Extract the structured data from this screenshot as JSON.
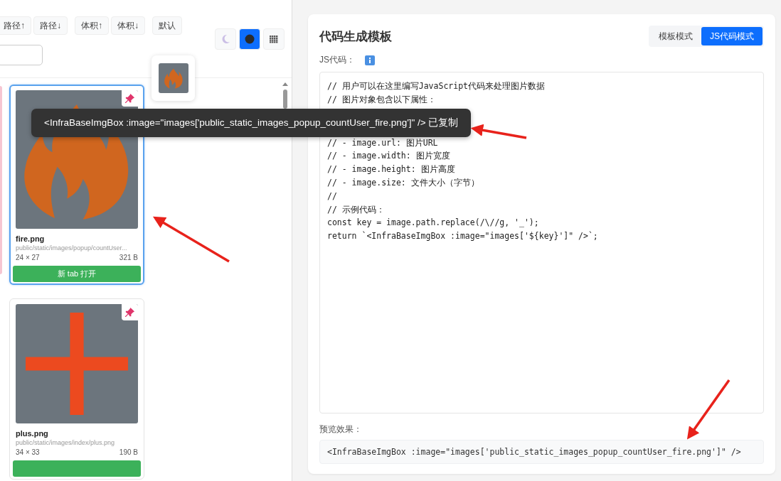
{
  "sort_groups": [
    [
      {
        "label": "路径↑"
      },
      {
        "label": "路径↓"
      }
    ],
    [
      {
        "label": "体积↑"
      },
      {
        "label": "体积↓"
      }
    ],
    [
      {
        "label": "默认"
      }
    ]
  ],
  "view_modes": [
    {
      "kind": "moon",
      "selected": false
    },
    {
      "kind": "dark",
      "selected": true
    },
    {
      "kind": "grid",
      "selected": false
    }
  ],
  "hover_preview": {
    "kind": "flame"
  },
  "cards": [
    {
      "kind": "flame",
      "name": "fire.png",
      "path": "public/static/images/popup/countUser...",
      "dimensions": "24 × 27",
      "size": "321 B",
      "button": "新 tab 打开",
      "selected": true
    },
    {
      "kind": "plus",
      "name": "plus.png",
      "path": "public/static/images/index/plus.png",
      "dimensions": "34 × 33",
      "size": "190 B",
      "selected": false
    }
  ],
  "toast": {
    "text": "<InfraBaseImgBox :image=\"images['public_static_images_popup_countUser_fire.png']\" /> 已复制"
  },
  "panel": {
    "title": "代码生成模板",
    "modes": [
      {
        "label": "模板模式",
        "selected": false
      },
      {
        "label": "JS代码模式",
        "selected": true
      }
    ],
    "code_label": "JS代码：",
    "code_lines_top": [
      "// 用户可以在这里编写JavaScript代码来处理图片数据",
      "// 图片对象包含以下属性："
    ],
    "code_lines_bottom": [
      "// - image.url: 图片URL",
      "// - image.width: 图片宽度",
      "// - image.height: 图片高度",
      "// - image.size: 文件大小（字节）",
      "//",
      "// 示例代码：",
      "const key = image.path.replace(/\\//g, '_');",
      "return `<InfraBaseImgBox :image=\"images['${key}']\" />`;"
    ],
    "preview_label": "预览效果：",
    "preview": "<InfraBaseImgBox :image=\"images['public_static_images_popup_countUser_fire.png']\" />"
  }
}
